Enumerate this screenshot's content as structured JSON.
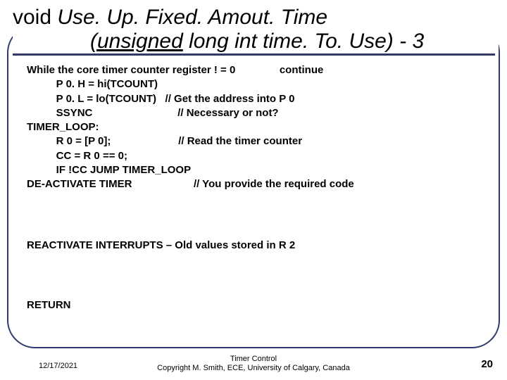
{
  "title": {
    "voidkw": "void ",
    "funcname": "Use. Up. Fixed. Amout. Time",
    "sig_open": "(unsigned",
    "sig_rest": " long int time. To. Use) - 3"
  },
  "code": "While the core timer counter register ! = 0               continue\n          P 0. H = hi(TCOUNT)\n          P 0. L = lo(TCOUNT)   // Get the address into P 0\n          SSYNC                             // Necessary or not?\nTIMER_LOOP:\n          R 0 = [P 0];                       // Read the timer counter\n          CC = R 0 == 0;\n          IF !CC JUMP TIMER_LOOP\nDE-ACTIVATE TIMER                     // You provide the required code",
  "reactivate": "REACTIVATE INTERRUPTS – Old values stored in R 2",
  "returnkw": "RETURN",
  "footer": {
    "date": "12/17/2021",
    "center_line1": "Timer Control",
    "center_line2": "Copyright M. Smith, ECE, University of Calgary, Canada",
    "pagenum": "20"
  }
}
